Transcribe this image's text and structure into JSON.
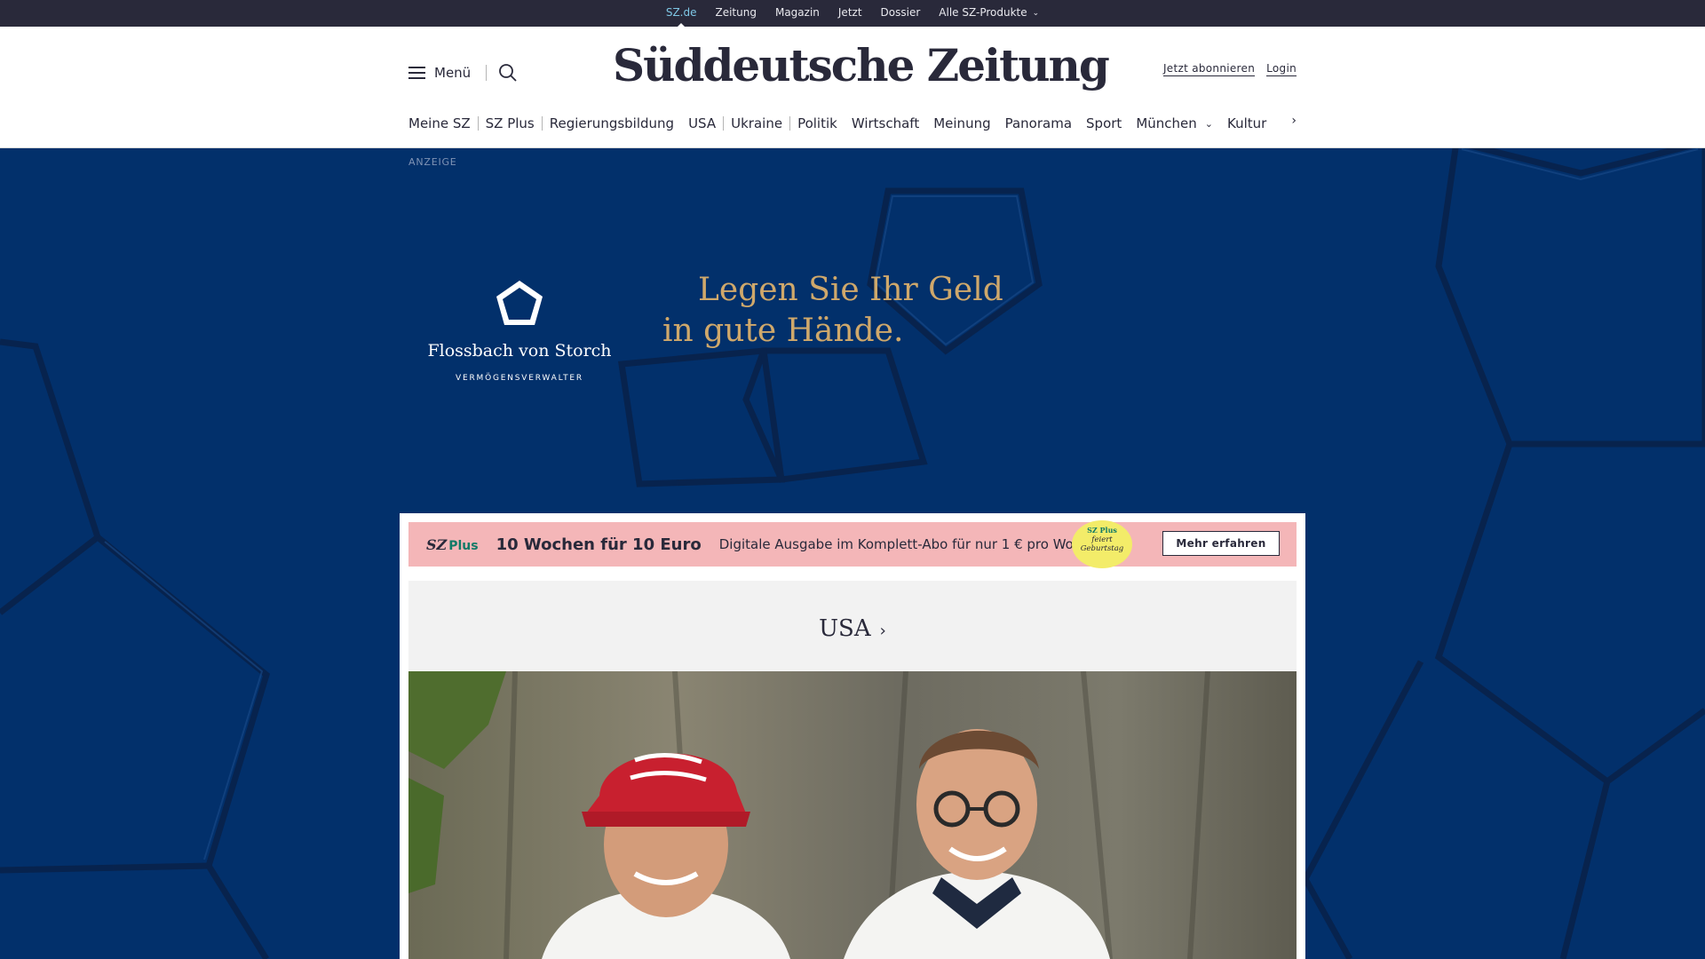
{
  "service_bar": {
    "items": [
      "SZ.de",
      "Zeitung",
      "Magazin",
      "Jetzt",
      "Dossier",
      "Alle SZ-Produkte"
    ]
  },
  "header": {
    "menu_label": "Menü",
    "logo_text": "Süddeutsche Zeitung",
    "subscribe_label": "Jetzt abonnieren",
    "login_label": "Login"
  },
  "nav": {
    "items": [
      "Meine SZ",
      "SZ Plus",
      "Regierungsbildung",
      "USA",
      "Ukraine",
      "Politik",
      "Wirtschaft",
      "Meinung",
      "Panorama",
      "Sport",
      "München",
      "Kultur"
    ]
  },
  "ad": {
    "label": "ANZEIGE",
    "brand": "Flossbach von Storch",
    "brand_sub": "VERMÖGENSVERWALTER",
    "headline": "Legen Sie Ihr Geld in gute Hände."
  },
  "promo": {
    "logo_sz": "SZ",
    "logo_plus": "Plus",
    "title": "10 Wochen für 10 Euro",
    "text": "Digitale Ausgabe im Komplett-Abo für nur 1 € pro Woche.",
    "badge_line1": "SZ Plus",
    "badge_line2": "feiert",
    "badge_line3": "Geburtstag",
    "button": "Mehr erfahren"
  },
  "section": {
    "title": "USA"
  },
  "colors": {
    "service_bar_bg": "#29293a",
    "ad_bg": "#02306b",
    "ad_gold": "#cfa86b",
    "promo_bg": "#f4b6b8",
    "promo_badge": "#f3ec69",
    "active_link": "#7fc8e6"
  }
}
